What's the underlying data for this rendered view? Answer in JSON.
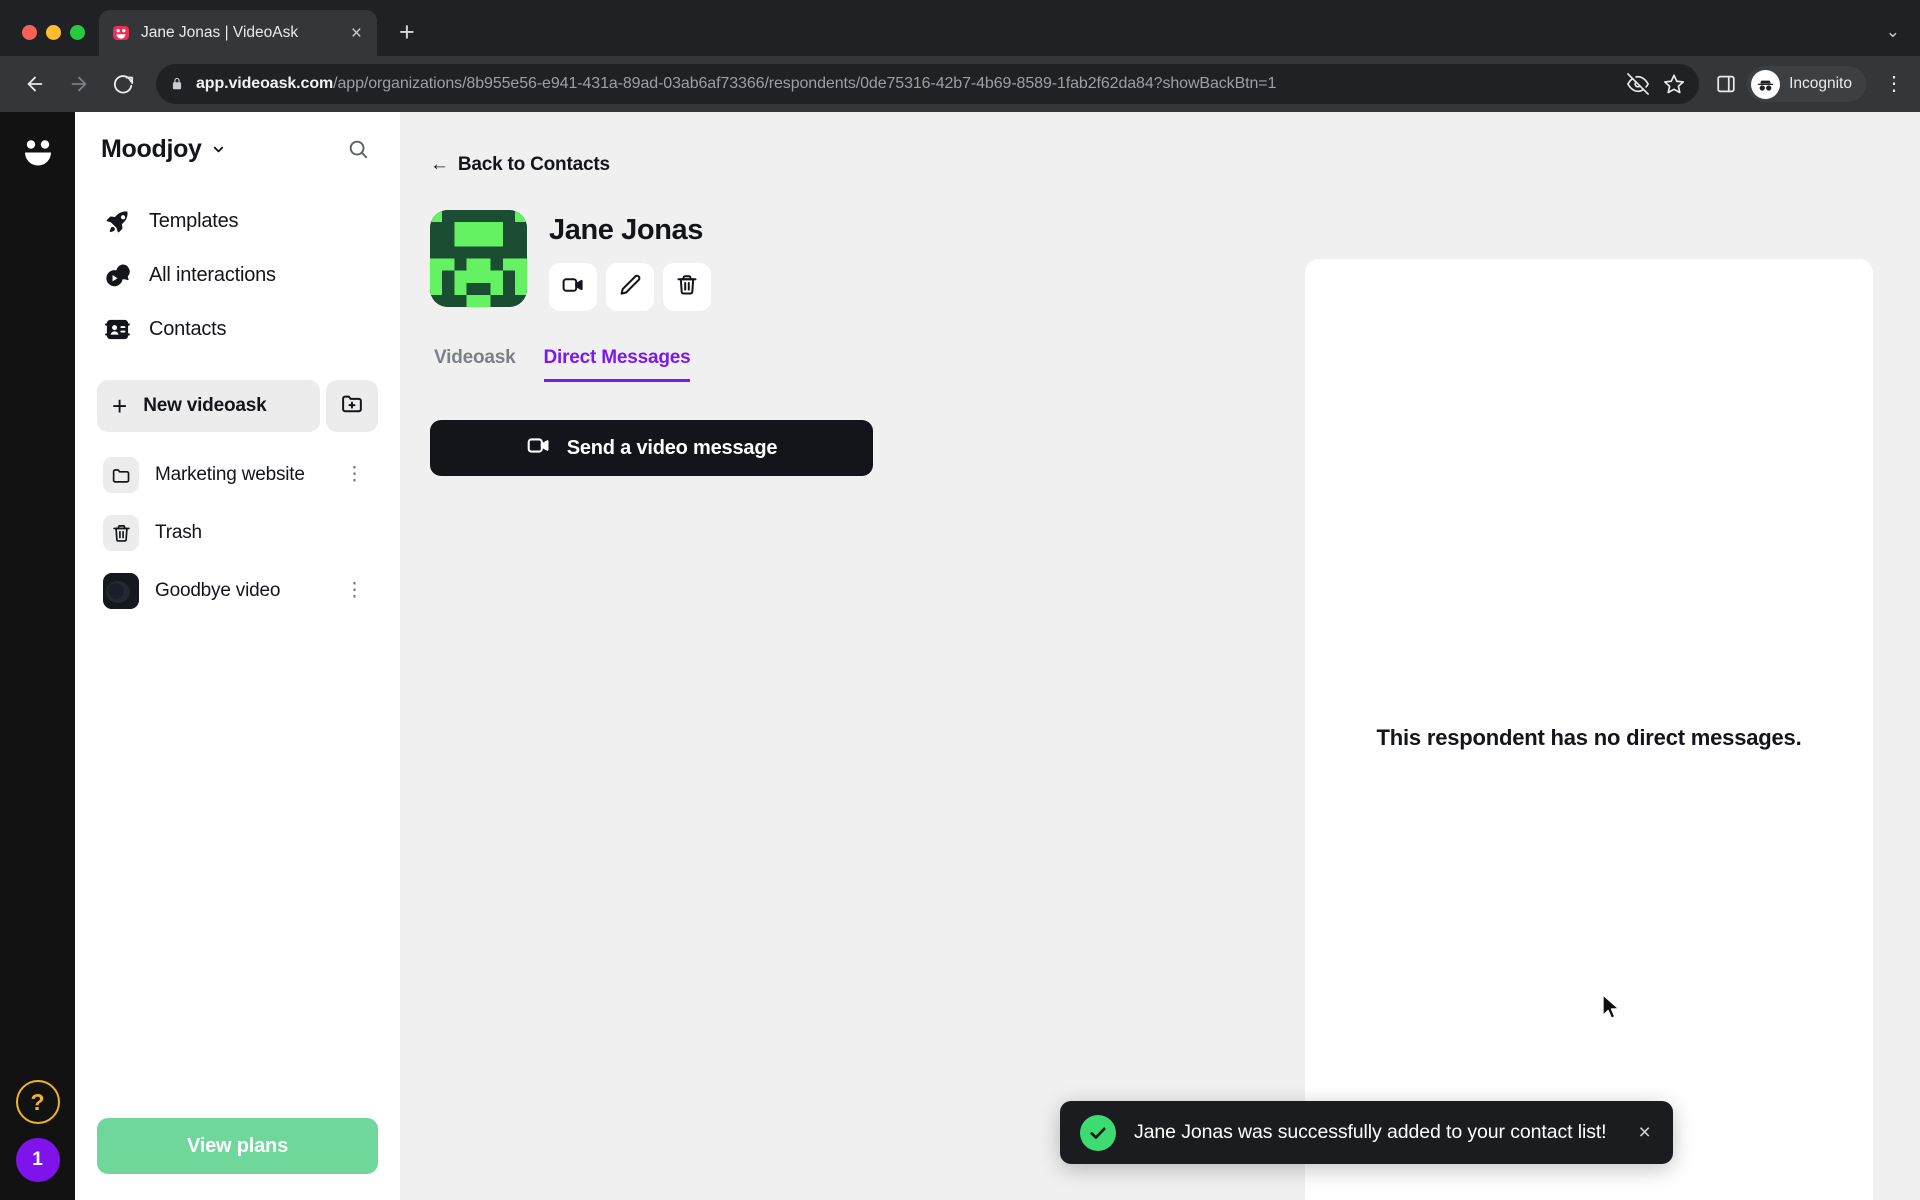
{
  "browser": {
    "tab": {
      "title": "Jane Jonas | VideoAsk",
      "favicon_name": "videoask-favicon",
      "close_label": "×"
    },
    "new_tab_label": "+",
    "tabstrip_expand_label": "⌄",
    "nav": {
      "back_label": "←",
      "forward_label": "→",
      "reload_label": "↻"
    },
    "omnibox": {
      "url_host": "app.videoask.com",
      "url_path": "/app/organizations/8b955e56-e941-431a-89ad-03ab6af73366/respondents/0de75316-42b7-4b69-8589-1fab2f62da84?showBackBtn=1",
      "lock_icon": "lock-icon"
    },
    "actions": {
      "tracking_protection": "eye-off-icon",
      "bookmark": "star-icon",
      "side_panel": "side-panel-icon",
      "profile_label": "Incognito",
      "menu_label": "⋮"
    }
  },
  "rail": {
    "logo_name": "videoask-logo",
    "help_label": "?",
    "badge_count": "1"
  },
  "sidebar": {
    "org_name": "Moodjoy",
    "search_icon": "search-icon",
    "nav": [
      {
        "label": "Templates",
        "icon": "rocket-icon"
      },
      {
        "label": "All interactions",
        "icon": "play-bubble-icon"
      },
      {
        "label": "Contacts",
        "icon": "contacts-icon"
      }
    ],
    "new_videoask_label": "New videoask",
    "new_videoask_plus": "+",
    "new_folder_icon": "folder-plus-icon",
    "folders": [
      {
        "label": "Marketing website",
        "icon": "folder-icon",
        "more": "⋮",
        "has_more": true
      },
      {
        "label": "Trash",
        "icon": "trash-icon",
        "more": "⋮",
        "has_more": false
      },
      {
        "label": "Goodbye video",
        "icon": "video-thumbnail",
        "more": "⋮",
        "has_more": true
      }
    ],
    "view_plans_label": "View plans"
  },
  "detail": {
    "back_label": "Back to Contacts",
    "back_arrow": "←",
    "contact_name": "Jane Jonas",
    "avatar_name": "jane-jonas-avatar",
    "actions": [
      {
        "name": "video-message-button",
        "icon": "video-camera-icon"
      },
      {
        "name": "edit-contact-button",
        "icon": "pencil-icon"
      },
      {
        "name": "delete-contact-button",
        "icon": "trash-icon"
      }
    ],
    "tabs": [
      {
        "label": "Videoask",
        "active": false
      },
      {
        "label": "Direct Messages",
        "active": true
      }
    ],
    "send_button_label": "Send a video message",
    "send_button_icon": "video-camera-icon"
  },
  "content": {
    "empty_message": "This respondent has no direct messages."
  },
  "toast": {
    "message": "Jane Jonas was successfully added to your contact list!",
    "icon": "check-circle-icon",
    "close_label": "×"
  },
  "colors": {
    "accent_purple": "#7c18ef",
    "success_green": "#3ddc73",
    "plans_green": "#6fd79a",
    "help_yellow": "#f0b429",
    "badge_purple": "#7f13ec"
  }
}
